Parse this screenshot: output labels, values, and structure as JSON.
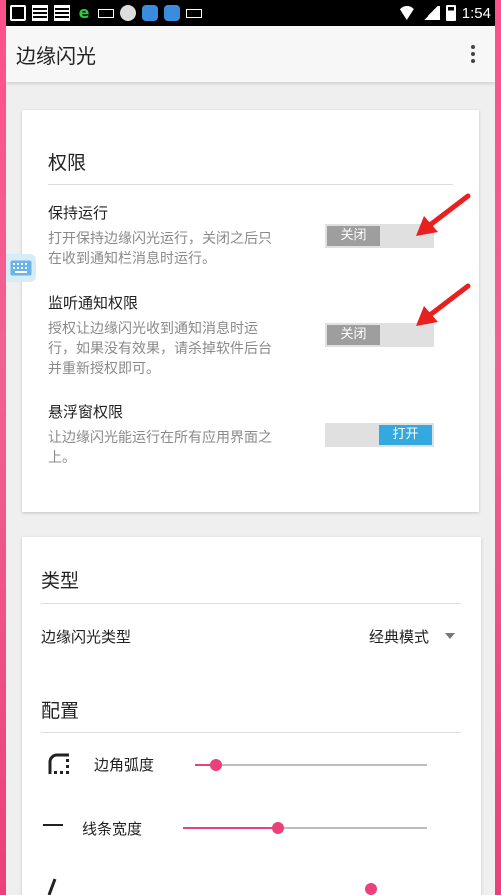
{
  "status_bar": {
    "time": "1:54"
  },
  "app_bar": {
    "title": "边缘闪光",
    "menu_icon": "more-vert-icon"
  },
  "permissions": {
    "section_title": "权限",
    "items": [
      {
        "title": "保持运行",
        "summary_lines": [
          "打开保持边缘闪光运行，关闭之后只",
          "在收到通知栏消息时运行。"
        ],
        "toggle_label": "关闭",
        "state": "off"
      },
      {
        "title": "监听通知权限",
        "summary_lines": [
          "授权让边缘闪光收到通知消息时运",
          "行，如果没有效果，请杀掉软件后台",
          "并重新授权即可。"
        ],
        "toggle_label": "关闭",
        "state": "off"
      },
      {
        "title": "悬浮窗权限",
        "summary_lines": [
          "让边缘闪光能运行在所有应用界面之",
          "上。"
        ],
        "toggle_label": "打开",
        "state": "on"
      }
    ]
  },
  "type_section": {
    "section_title": "类型",
    "edge_type_label": "边缘闪光类型",
    "edge_type_value": "经典模式"
  },
  "config_section": {
    "section_title": "配置",
    "sliders": [
      {
        "label": "边角弧度",
        "icon": "rounded-corner-icon",
        "value_fraction": 0.09
      },
      {
        "label": "线条宽度",
        "icon": "line-width-icon",
        "value_fraction": 0.39
      }
    ]
  },
  "colors": {
    "accent": "#ec407a",
    "toggle_on": "#33a9e0",
    "toggle_off": "#9e9e9e",
    "arrow": "#e82020"
  }
}
